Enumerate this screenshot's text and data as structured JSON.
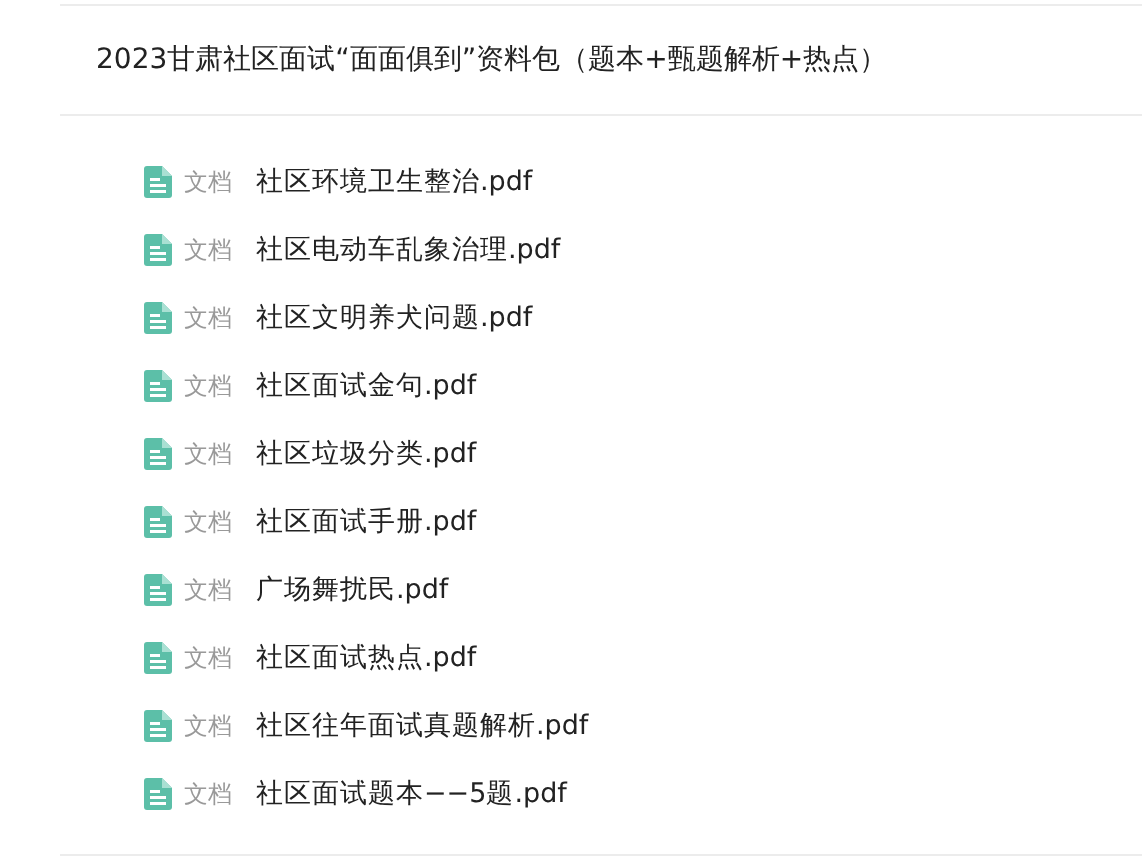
{
  "package": {
    "title": "2023甘肃社区面试“面面俱到”资料包（题本+甄题解析+热点）"
  },
  "files": [
    {
      "kind": "document",
      "type_label": "文档",
      "name": "社区环境卫生整治.pdf"
    },
    {
      "kind": "document",
      "type_label": "文档",
      "name": "社区电动车乱象治理.pdf"
    },
    {
      "kind": "document",
      "type_label": "文档",
      "name": "社区文明养犬问题.pdf"
    },
    {
      "kind": "document",
      "type_label": "文档",
      "name": "社区面试金句.pdf"
    },
    {
      "kind": "document",
      "type_label": "文档",
      "name": "社区垃圾分类.pdf"
    },
    {
      "kind": "document",
      "type_label": "文档",
      "name": "社区面试手册.pdf"
    },
    {
      "kind": "document",
      "type_label": "文档",
      "name": "广场舞扰民.pdf"
    },
    {
      "kind": "document",
      "type_label": "文档",
      "name": "社区面试热点.pdf"
    },
    {
      "kind": "document",
      "type_label": "文档",
      "name": "社区往年面试真题解析.pdf"
    },
    {
      "kind": "document",
      "type_label": "文档",
      "name": "社区面试题本−−5题.pdf"
    }
  ]
}
